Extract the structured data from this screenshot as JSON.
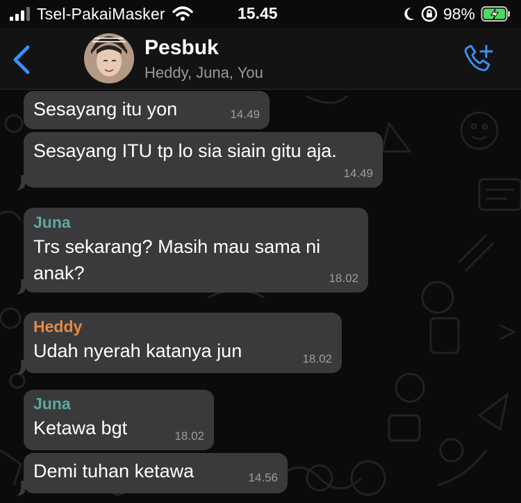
{
  "status_bar": {
    "carrier": "Tsel-PakaiMasker",
    "time": "15.45",
    "battery_percent": "98%"
  },
  "header": {
    "back_icon": "chevron-left-icon",
    "title": "Pesbuk",
    "subtitle": "Heddy, Juna, You",
    "call_icon": "add-call-icon",
    "accent_color": "#3b8ff5"
  },
  "messages": [
    {
      "sender": "",
      "text": "Sesayang itu yon",
      "time": "14.49"
    },
    {
      "sender": "",
      "text": "Sesayang ITU tp lo sia siain gitu aja.",
      "time": "14.49"
    },
    {
      "sender": "Juna",
      "text": "Trs sekarang? Masih mau sama ni anak?",
      "time": "18.02",
      "sender_color": "#5fa8a0"
    },
    {
      "sender": "Heddy",
      "text": "Udah nyerah katanya jun",
      "time": "18.02",
      "sender_color": "#e58a43"
    },
    {
      "sender": "Juna",
      "text": "Ketawa bgt",
      "time": "18.02",
      "sender_color": "#5fa8a0"
    },
    {
      "sender": "",
      "text": "Demi tuhan ketawa",
      "time": "14.56"
    }
  ]
}
